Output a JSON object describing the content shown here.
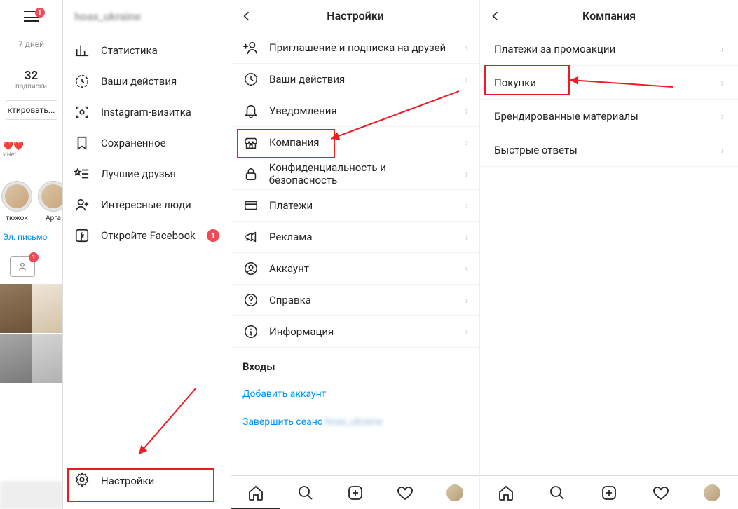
{
  "panel1": {
    "hamburger_badge": "1",
    "days": "7 дней",
    "subscriptions_count": "32",
    "subscriptions_label": "подписки",
    "edit_btn": "ктировать...",
    "hearts": "❤️❤️",
    "mini_line": "ине:",
    "story1": "тюжок",
    "story2": "Арга",
    "email_label": "Эл. письмо",
    "tagged_badge": "1",
    "username_blur": "hoax_ukraine",
    "menu": [
      {
        "icon": "stats",
        "label": "Статистика"
      },
      {
        "icon": "activity",
        "label": "Ваши действия"
      },
      {
        "icon": "nametag",
        "label": "Instagram-визитка"
      },
      {
        "icon": "bookmark",
        "label": "Сохраненное"
      },
      {
        "icon": "star-list",
        "label": "Лучшие друзья"
      },
      {
        "icon": "add-user",
        "label": "Интересные люди"
      },
      {
        "icon": "facebook",
        "label": "Откройте Facebook",
        "badge": "1"
      }
    ],
    "settings_label": "Настройки"
  },
  "panel2": {
    "title": "Настройки",
    "rows": [
      {
        "icon": "invite",
        "label": "Приглашение и подписка на друзей"
      },
      {
        "icon": "activity",
        "label": "Ваши действия"
      },
      {
        "icon": "bell",
        "label": "Уведомления"
      },
      {
        "icon": "company",
        "label": "Компания"
      },
      {
        "icon": "lock",
        "label": "Конфиденциальность и безопасность"
      },
      {
        "icon": "card",
        "label": "Платежи"
      },
      {
        "icon": "megaphone",
        "label": "Реклама"
      },
      {
        "icon": "account",
        "label": "Аккаунт"
      },
      {
        "icon": "help",
        "label": "Справка"
      },
      {
        "icon": "info",
        "label": "Информация"
      }
    ],
    "logins_header": "Входы",
    "add_account": "Добавить аккаунт",
    "logout_prefix": "Завершить сеанс ",
    "logout_user": "hoax_ukraine"
  },
  "panel3": {
    "title": "Компания",
    "rows": [
      {
        "label": "Платежи за промоакции"
      },
      {
        "label": "Покупки"
      },
      {
        "label": "Брендированные материалы"
      },
      {
        "label": "Быстрые ответы"
      }
    ]
  }
}
